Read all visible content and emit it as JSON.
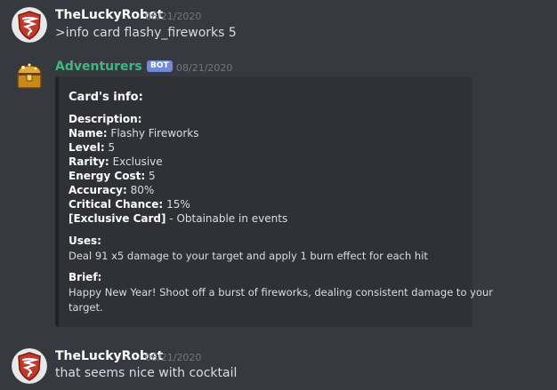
{
  "messages": [
    {
      "author": "TheLuckyRobot",
      "timestamp": "08/21/2020",
      "content": ">info card flashy_fireworks 5",
      "author_color": "#ffffff"
    },
    {
      "author": "Adventurers Bot",
      "bot_tag": "BOT",
      "timestamp": "08/21/2020",
      "author_color": "#43b581",
      "embed": {
        "title": "Card's info:",
        "description_label": "Description:",
        "fields": [
          {
            "label": "Name:",
            "value": "Flashy Fireworks"
          },
          {
            "label": "Level:",
            "value": "5"
          },
          {
            "label": "Rarity:",
            "value": "Exclusive"
          },
          {
            "label": "Energy Cost:",
            "value": "5"
          },
          {
            "label": "Accuracy:",
            "value": "80%"
          },
          {
            "label": "Critical Chance:",
            "value": "15%"
          },
          {
            "label": "[Exclusive Card]",
            "value": " - Obtainable in events"
          }
        ],
        "uses_label": "Uses:",
        "uses_text": "Deal 91 x5 damage to your target and apply 1 burn effect for each hit",
        "brief_label": "Brief:",
        "brief_line1": "Happy New Year! Shoot off a burst of fireworks, dealing consistent damage to your",
        "brief_line2": "target."
      }
    },
    {
      "author": "TheLuckyRobot",
      "timestamp": "08/21/2020",
      "content": "that seems nice with cocktail",
      "author_color": "#ffffff"
    }
  ],
  "icons": {
    "user_avatar": "tornado-shield-icon",
    "bot_avatar": "treasure-chest-icon"
  },
  "colors": {
    "background": "#36393f",
    "embed_bg": "#2f3136",
    "bot_tag": "#7289da"
  }
}
